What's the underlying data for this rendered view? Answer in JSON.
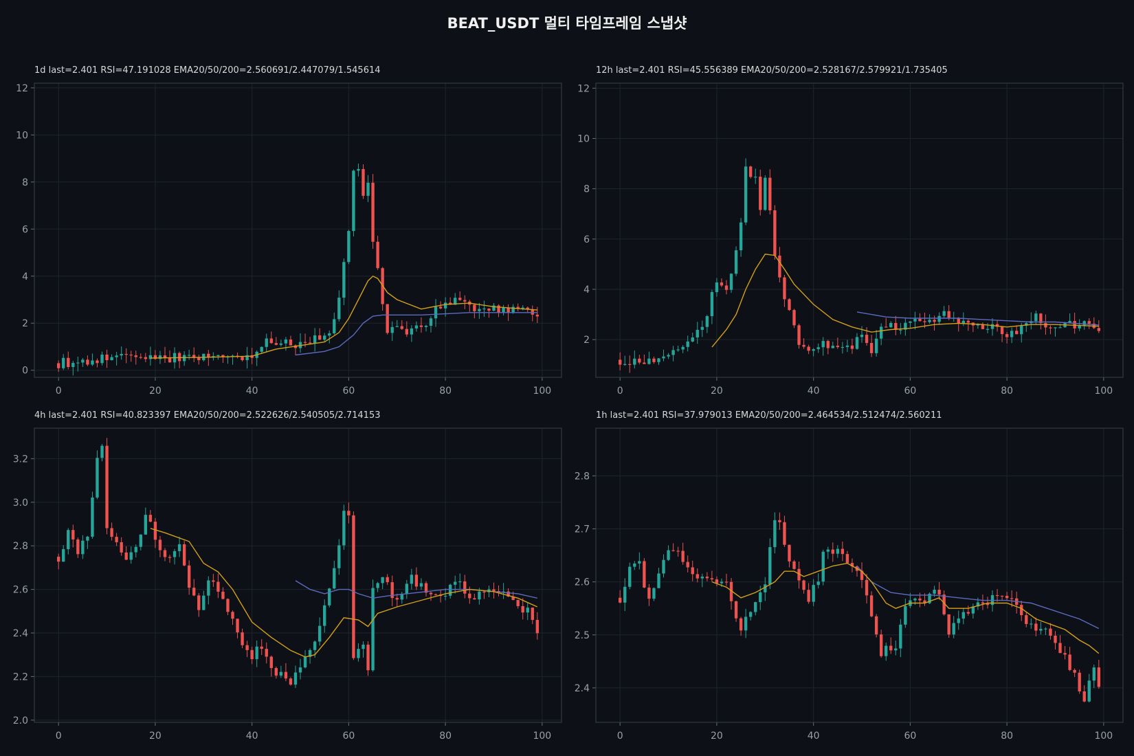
{
  "title": "BEAT_USDT  멀티 타임프레임 스냅샷",
  "colors": {
    "background": "#0d1117",
    "up": "#26a69a",
    "down": "#ef5350",
    "ema20": "#d4a017",
    "ema50": "#5c6bc0",
    "grid": "#1f242c",
    "frame": "#3a3f47"
  },
  "panels": [
    {
      "label": "1d  last=2.401  RSI=47.191028  EMA20/50/200=2.560691/2.447079/1.545614",
      "xticks": [
        "0",
        "20",
        "40",
        "60",
        "80",
        "100"
      ],
      "yticks": [
        "0",
        "2",
        "4",
        "6",
        "8",
        "10",
        "12"
      ]
    },
    {
      "label": "12h  last=2.401  RSI=45.556389  EMA20/50/200=2.528167/2.579921/1.735405",
      "xticks": [
        "0",
        "20",
        "40",
        "60",
        "80",
        "100"
      ],
      "yticks": [
        "2",
        "4",
        "6",
        "8",
        "10",
        "12"
      ]
    },
    {
      "label": "4h  last=2.401  RSI=40.823397  EMA20/50/200=2.522626/2.540505/2.714153",
      "xticks": [
        "0",
        "20",
        "40",
        "60",
        "80",
        "100"
      ],
      "yticks": [
        "2.0",
        "2.2",
        "2.4",
        "2.6",
        "2.8",
        "3.0",
        "3.2"
      ]
    },
    {
      "label": "1h  last=2.401  RSI=37.979013  EMA20/50/200=2.464534/2.512474/2.560211",
      "xticks": [
        "0",
        "20",
        "40",
        "60",
        "80",
        "100"
      ],
      "yticks": [
        "2.4",
        "2.5",
        "2.6",
        "2.7",
        "2.8"
      ]
    }
  ],
  "chart_data": [
    {
      "type": "candlestick",
      "timeframe": "1d",
      "xlim": [
        -5,
        104
      ],
      "ylim": [
        -0.3,
        12.2
      ],
      "close_path": [
        [
          0,
          0.3
        ],
        [
          6,
          0.4
        ],
        [
          12,
          0.55
        ],
        [
          18,
          0.55
        ],
        [
          25,
          0.55
        ],
        [
          32,
          0.6
        ],
        [
          38,
          0.62
        ],
        [
          40,
          0.62
        ],
        [
          41,
          0.9
        ],
        [
          43,
          1.2
        ],
        [
          45,
          1.1
        ],
        [
          48,
          1.1
        ],
        [
          52,
          1.2
        ],
        [
          55,
          1.4
        ],
        [
          57,
          2.0
        ],
        [
          58,
          3.0
        ],
        [
          59,
          4.5
        ],
        [
          60,
          6.0
        ],
        [
          61,
          8.4
        ],
        [
          62,
          8.5
        ],
        [
          63,
          7.5
        ],
        [
          64,
          7.8
        ],
        [
          65,
          5.5
        ],
        [
          66,
          4.5
        ],
        [
          67,
          2.8
        ],
        [
          68,
          1.6
        ],
        [
          70,
          1.8
        ],
        [
          72,
          1.7
        ],
        [
          74,
          1.8
        ],
        [
          76,
          2.0
        ],
        [
          78,
          2.6
        ],
        [
          82,
          2.9
        ],
        [
          84,
          3.0
        ],
        [
          86,
          2.6
        ],
        [
          88,
          2.5
        ],
        [
          92,
          2.6
        ],
        [
          96,
          2.6
        ],
        [
          99,
          2.4
        ]
      ],
      "ema20_path": [
        [
          19,
          0.52
        ],
        [
          30,
          0.55
        ],
        [
          40,
          0.6
        ],
        [
          45,
          0.9
        ],
        [
          55,
          1.2
        ],
        [
          58,
          1.6
        ],
        [
          60,
          2.2
        ],
        [
          62,
          3.0
        ],
        [
          64,
          3.8
        ],
        [
          65,
          4.0
        ],
        [
          66,
          3.9
        ],
        [
          68,
          3.3
        ],
        [
          70,
          3.0
        ],
        [
          75,
          2.6
        ],
        [
          80,
          2.8
        ],
        [
          85,
          2.85
        ],
        [
          90,
          2.7
        ],
        [
          99,
          2.56
        ]
      ],
      "ema50_path": [
        [
          49,
          0.65
        ],
        [
          55,
          0.8
        ],
        [
          58,
          1.0
        ],
        [
          61,
          1.5
        ],
        [
          63,
          2.0
        ],
        [
          65,
          2.3
        ],
        [
          67,
          2.35
        ],
        [
          75,
          2.35
        ],
        [
          85,
          2.45
        ],
        [
          99,
          2.45
        ]
      ]
    },
    {
      "type": "candlestick",
      "timeframe": "12h",
      "xlim": [
        -5,
        104
      ],
      "ylim": [
        0.5,
        12.2
      ],
      "close_path": [
        [
          0,
          1.2
        ],
        [
          3,
          1.2
        ],
        [
          6,
          1.15
        ],
        [
          8,
          1.1
        ],
        [
          10,
          1.3
        ],
        [
          13,
          1.6
        ],
        [
          16,
          2.2
        ],
        [
          18,
          3.0
        ],
        [
          19,
          3.8
        ],
        [
          20,
          4.4
        ],
        [
          22,
          4.0
        ],
        [
          23,
          4.8
        ],
        [
          24,
          5.5
        ],
        [
          25,
          6.5
        ],
        [
          26,
          8.8
        ],
        [
          27,
          8.6
        ],
        [
          28,
          8.4
        ],
        [
          29,
          7.0
        ],
        [
          30,
          8.4
        ],
        [
          31,
          7.0
        ],
        [
          32,
          5.5
        ],
        [
          33,
          4.5
        ],
        [
          34,
          3.8
        ],
        [
          35,
          3.0
        ],
        [
          36,
          2.5
        ],
        [
          37,
          1.8
        ],
        [
          39,
          1.6
        ],
        [
          41,
          1.9
        ],
        [
          44,
          1.8
        ],
        [
          48,
          1.8
        ],
        [
          50,
          2.0
        ],
        [
          52,
          1.6
        ],
        [
          54,
          2.4
        ],
        [
          56,
          2.5
        ],
        [
          60,
          2.6
        ],
        [
          64,
          2.8
        ],
        [
          67,
          3.1
        ],
        [
          70,
          2.8
        ],
        [
          75,
          2.6
        ],
        [
          80,
          2.3
        ],
        [
          84,
          2.5
        ],
        [
          86,
          2.9
        ],
        [
          88,
          2.6
        ],
        [
          92,
          2.6
        ],
        [
          96,
          2.6
        ],
        [
          99,
          2.4
        ]
      ],
      "ema20_path": [
        [
          19,
          1.7
        ],
        [
          22,
          2.4
        ],
        [
          24,
          3.0
        ],
        [
          26,
          4.0
        ],
        [
          28,
          4.8
        ],
        [
          30,
          5.4
        ],
        [
          32,
          5.35
        ],
        [
          34,
          4.8
        ],
        [
          36,
          4.2
        ],
        [
          40,
          3.4
        ],
        [
          44,
          2.8
        ],
        [
          48,
          2.5
        ],
        [
          52,
          2.3
        ],
        [
          56,
          2.4
        ],
        [
          60,
          2.45
        ],
        [
          65,
          2.6
        ],
        [
          70,
          2.65
        ],
        [
          75,
          2.6
        ],
        [
          80,
          2.5
        ],
        [
          85,
          2.6
        ],
        [
          90,
          2.6
        ],
        [
          99,
          2.53
        ]
      ],
      "ema50_path": [
        [
          49,
          3.1
        ],
        [
          55,
          2.9
        ],
        [
          60,
          2.85
        ],
        [
          65,
          2.85
        ],
        [
          70,
          2.85
        ],
        [
          75,
          2.8
        ],
        [
          80,
          2.75
        ],
        [
          85,
          2.7
        ],
        [
          90,
          2.7
        ],
        [
          99,
          2.58
        ]
      ]
    },
    {
      "type": "candlestick",
      "timeframe": "4h",
      "xlim": [
        -5,
        104
      ],
      "ylim": [
        1.99,
        3.34
      ],
      "close_path": [
        [
          0,
          2.75
        ],
        [
          2,
          2.85
        ],
        [
          4,
          2.78
        ],
        [
          6,
          2.85
        ],
        [
          8,
          3.2
        ],
        [
          9,
          3.25
        ],
        [
          10,
          2.9
        ],
        [
          12,
          2.8
        ],
        [
          14,
          2.72
        ],
        [
          16,
          2.8
        ],
        [
          18,
          2.95
        ],
        [
          20,
          2.85
        ],
        [
          22,
          2.75
        ],
        [
          25,
          2.8
        ],
        [
          27,
          2.6
        ],
        [
          29,
          2.5
        ],
        [
          31,
          2.65
        ],
        [
          33,
          2.6
        ],
        [
          35,
          2.5
        ],
        [
          37,
          2.4
        ],
        [
          40,
          2.3
        ],
        [
          42,
          2.35
        ],
        [
          44,
          2.25
        ],
        [
          46,
          2.2
        ],
        [
          48,
          2.15
        ],
        [
          50,
          2.25
        ],
        [
          52,
          2.3
        ],
        [
          54,
          2.45
        ],
        [
          56,
          2.6
        ],
        [
          58,
          2.8
        ],
        [
          59,
          2.95
        ],
        [
          60,
          2.95
        ],
        [
          61,
          2.3
        ],
        [
          63,
          2.35
        ],
        [
          64,
          2.25
        ],
        [
          65,
          2.6
        ],
        [
          67,
          2.65
        ],
        [
          70,
          2.55
        ],
        [
          73,
          2.65
        ],
        [
          76,
          2.6
        ],
        [
          79,
          2.55
        ],
        [
          82,
          2.65
        ],
        [
          85,
          2.55
        ],
        [
          88,
          2.58
        ],
        [
          91,
          2.6
        ],
        [
          94,
          2.55
        ],
        [
          97,
          2.5
        ],
        [
          99,
          2.4
        ]
      ],
      "ema20_path": [
        [
          19,
          2.88
        ],
        [
          22,
          2.86
        ],
        [
          27,
          2.82
        ],
        [
          30,
          2.72
        ],
        [
          33,
          2.68
        ],
        [
          36,
          2.6
        ],
        [
          40,
          2.45
        ],
        [
          44,
          2.38
        ],
        [
          48,
          2.32
        ],
        [
          51,
          2.29
        ],
        [
          53,
          2.3
        ],
        [
          56,
          2.38
        ],
        [
          59,
          2.47
        ],
        [
          62,
          2.46
        ],
        [
          64,
          2.43
        ],
        [
          66,
          2.49
        ],
        [
          70,
          2.52
        ],
        [
          75,
          2.55
        ],
        [
          80,
          2.58
        ],
        [
          85,
          2.6
        ],
        [
          90,
          2.59
        ],
        [
          95,
          2.56
        ],
        [
          99,
          2.52
        ]
      ],
      "ema50_path": [
        [
          49,
          2.64
        ],
        [
          52,
          2.6
        ],
        [
          55,
          2.58
        ],
        [
          58,
          2.6
        ],
        [
          60,
          2.6
        ],
        [
          62,
          2.58
        ],
        [
          65,
          2.56
        ],
        [
          68,
          2.57
        ],
        [
          72,
          2.58
        ],
        [
          76,
          2.59
        ],
        [
          80,
          2.6
        ],
        [
          85,
          2.6
        ],
        [
          90,
          2.59
        ],
        [
          95,
          2.58
        ],
        [
          99,
          2.56
        ]
      ]
    },
    {
      "type": "candlestick",
      "timeframe": "1h",
      "xlim": [
        -5,
        104
      ],
      "ylim": [
        2.335,
        2.89
      ],
      "close_path": [
        [
          0,
          2.57
        ],
        [
          2,
          2.62
        ],
        [
          4,
          2.63
        ],
        [
          6,
          2.56
        ],
        [
          8,
          2.62
        ],
        [
          10,
          2.66
        ],
        [
          12,
          2.65
        ],
        [
          14,
          2.62
        ],
        [
          16,
          2.6
        ],
        [
          18,
          2.61
        ],
        [
          20,
          2.59
        ],
        [
          22,
          2.6
        ],
        [
          24,
          2.54
        ],
        [
          25,
          2.51
        ],
        [
          27,
          2.55
        ],
        [
          30,
          2.6
        ],
        [
          32,
          2.72
        ],
        [
          33,
          2.72
        ],
        [
          35,
          2.63
        ],
        [
          37,
          2.6
        ],
        [
          39,
          2.57
        ],
        [
          41,
          2.6
        ],
        [
          42,
          2.66
        ],
        [
          44,
          2.66
        ],
        [
          46,
          2.65
        ],
        [
          48,
          2.63
        ],
        [
          50,
          2.6
        ],
        [
          52,
          2.53
        ],
        [
          54,
          2.46
        ],
        [
          55,
          2.48
        ],
        [
          57,
          2.47
        ],
        [
          59,
          2.55
        ],
        [
          61,
          2.57
        ],
        [
          63,
          2.56
        ],
        [
          65,
          2.59
        ],
        [
          66,
          2.57
        ],
        [
          68,
          2.5
        ],
        [
          70,
          2.54
        ],
        [
          72,
          2.55
        ],
        [
          75,
          2.56
        ],
        [
          78,
          2.57
        ],
        [
          80,
          2.57
        ],
        [
          82,
          2.56
        ],
        [
          84,
          2.53
        ],
        [
          86,
          2.5
        ],
        [
          88,
          2.52
        ],
        [
          90,
          2.48
        ],
        [
          92,
          2.46
        ],
        [
          94,
          2.42
        ],
        [
          96,
          2.38
        ],
        [
          98,
          2.43
        ],
        [
          99,
          2.4
        ]
      ],
      "ema20_path": [
        [
          19,
          2.6
        ],
        [
          22,
          2.59
        ],
        [
          25,
          2.57
        ],
        [
          28,
          2.58
        ],
        [
          30,
          2.59
        ],
        [
          32,
          2.6
        ],
        [
          34,
          2.62
        ],
        [
          36,
          2.62
        ],
        [
          38,
          2.61
        ],
        [
          41,
          2.62
        ],
        [
          44,
          2.63
        ],
        [
          47,
          2.635
        ],
        [
          50,
          2.62
        ],
        [
          52,
          2.6
        ],
        [
          55,
          2.56
        ],
        [
          57,
          2.55
        ],
        [
          60,
          2.56
        ],
        [
          63,
          2.56
        ],
        [
          66,
          2.57
        ],
        [
          68,
          2.55
        ],
        [
          72,
          2.55
        ],
        [
          76,
          2.56
        ],
        [
          80,
          2.56
        ],
        [
          83,
          2.55
        ],
        [
          86,
          2.53
        ],
        [
          89,
          2.52
        ],
        [
          92,
          2.51
        ],
        [
          95,
          2.49
        ],
        [
          97,
          2.48
        ],
        [
          99,
          2.465
        ]
      ],
      "ema50_path": [
        [
          49,
          2.63
        ],
        [
          52,
          2.6
        ],
        [
          56,
          2.58
        ],
        [
          60,
          2.575
        ],
        [
          65,
          2.575
        ],
        [
          70,
          2.57
        ],
        [
          75,
          2.565
        ],
        [
          80,
          2.565
        ],
        [
          85,
          2.56
        ],
        [
          90,
          2.545
        ],
        [
          95,
          2.53
        ],
        [
          99,
          2.512
        ]
      ]
    }
  ]
}
